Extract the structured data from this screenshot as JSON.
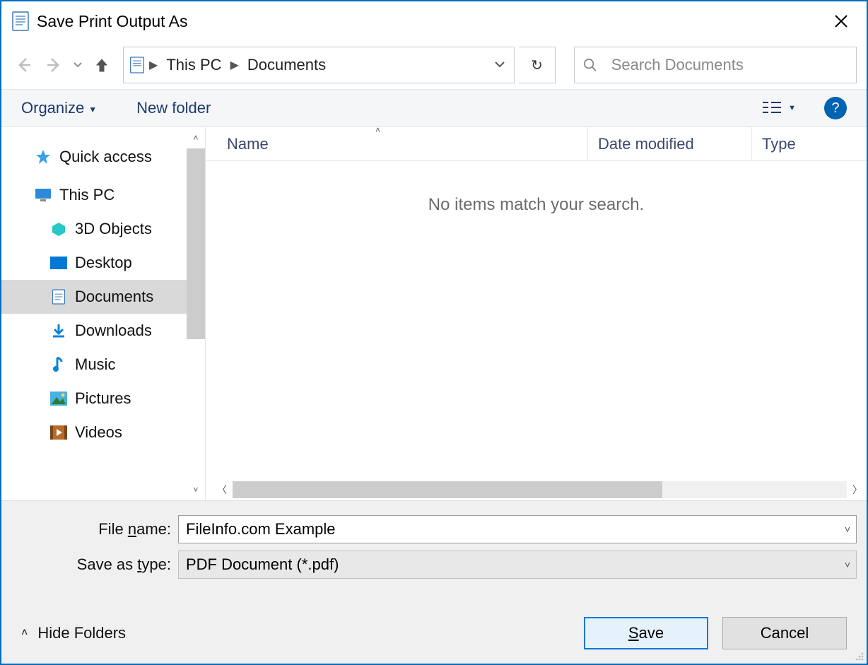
{
  "window": {
    "title": "Save Print Output As"
  },
  "breadcrumb": {
    "seg1": "This PC",
    "seg2": "Documents"
  },
  "search": {
    "placeholder": "Search Documents"
  },
  "toolbar": {
    "organize": "Organize",
    "newfolder": "New folder"
  },
  "tree": {
    "quick_access": "Quick access",
    "this_pc": "This PC",
    "objects3d": "3D Objects",
    "desktop": "Desktop",
    "documents": "Documents",
    "downloads": "Downloads",
    "music": "Music",
    "pictures": "Pictures",
    "videos": "Videos"
  },
  "columns": {
    "name": "Name",
    "date": "Date modified",
    "type": "Type"
  },
  "content": {
    "empty": "No items match your search."
  },
  "form": {
    "filename_label_pre": "File ",
    "filename_label_ul": "n",
    "filename_label_post": "ame:",
    "filename_value": "FileInfo.com Example",
    "saveastype_label_pre": "Save as ",
    "saveastype_label_ul": "t",
    "saveastype_label_post": "ype:",
    "saveastype_value": "PDF Document (*.pdf)"
  },
  "buttons": {
    "hide_folders": "Hide Folders",
    "save_pre": "",
    "save_ul": "S",
    "save_post": "ave",
    "cancel": "Cancel"
  }
}
